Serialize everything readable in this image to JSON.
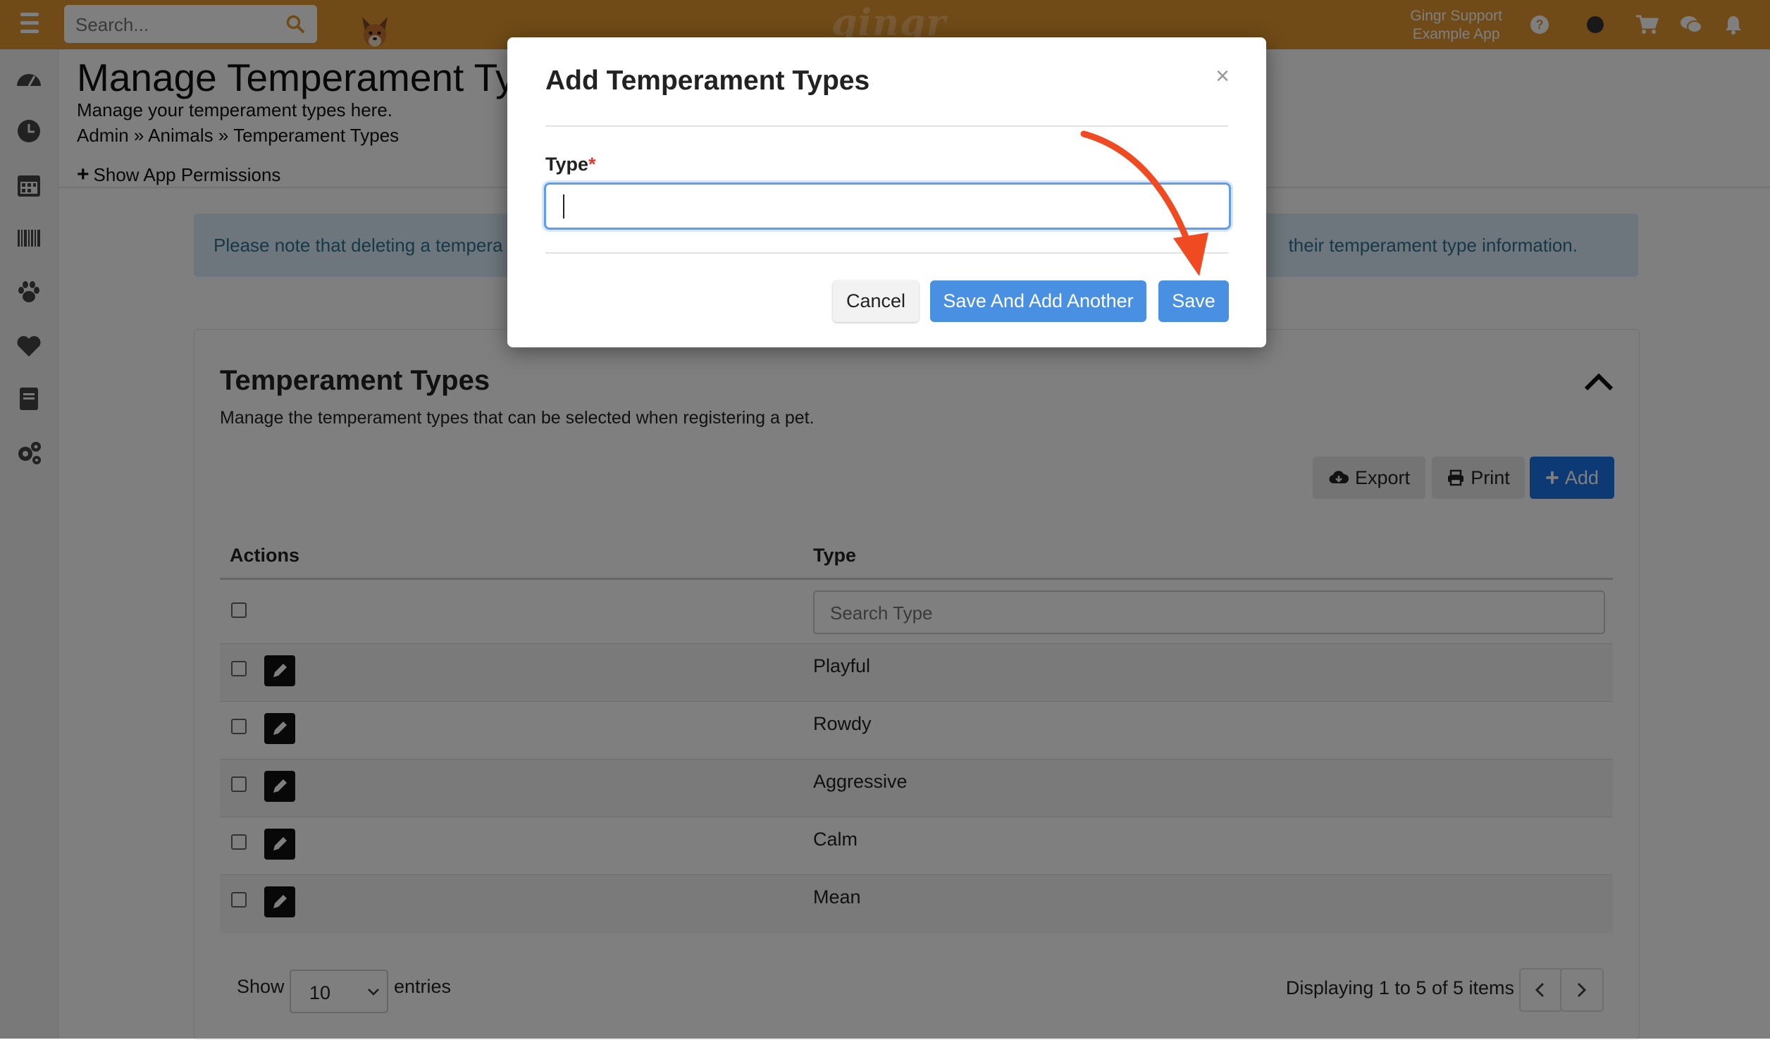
{
  "topbar": {
    "search_placeholder": "Search...",
    "logo_text": "gingr",
    "user_name": "Gingr Support",
    "app_name": "Example App",
    "colors": {
      "bar": "#e0962f",
      "accent_blue": "#1a73e8"
    }
  },
  "sidebar": {
    "icons": [
      "dashboard-icon",
      "clock-icon",
      "calendar-icon",
      "barcode-icon",
      "paw-icon",
      "heart-icon",
      "book-icon",
      "settings-gears-icon"
    ]
  },
  "page": {
    "title": "Manage Temperament Types",
    "subtitle": "Manage your temperament types here.",
    "breadcrumb": "Admin » Animals » Temperament Types",
    "permissions_link": "Show App Permissions",
    "alert_visible_start": "Please note that deleting a tempera",
    "alert_visible_end": "their temperament type information."
  },
  "card": {
    "title": "Temperament Types",
    "subtitle": "Manage the temperament types that can be selected when registering a pet.",
    "buttons": {
      "export": "Export",
      "print": "Print",
      "add": "Add"
    },
    "columns": [
      "Actions",
      "Type"
    ],
    "filter_placeholder": "Search Type",
    "rows": [
      "Playful",
      "Rowdy",
      "Aggressive",
      "Calm",
      "Mean"
    ],
    "footer": {
      "show": "Show",
      "page_length": "10",
      "entries": "entries",
      "info": "Displaying 1 to 5 of 5 items"
    }
  },
  "modal": {
    "title": "Add Temperament Types",
    "close": "×",
    "field_label": "Type",
    "required_mark": "*",
    "field_value": "",
    "buttons": {
      "cancel": "Cancel",
      "save_and_add": "Save And Add Another",
      "save": "Save"
    },
    "annotation_arrow_color": "#f04a23"
  }
}
